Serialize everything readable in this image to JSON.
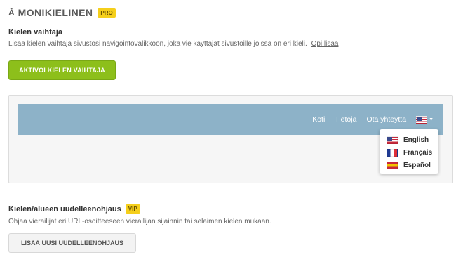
{
  "header": {
    "icon": "language-icon",
    "icon_glyph": "Ă",
    "title": "MONIKIELINEN",
    "badge": "PRO"
  },
  "switcher": {
    "title": "Kielen vaihtaja",
    "description": "Lisää kielen vaihtaja sivustosi navigointovalikkoon, joka vie käyttäjät sivustoille joissa on eri kieli.",
    "learn_more": "Opi lisää",
    "activate_button": "AKTIVOI KIELEN VAIHTAJA"
  },
  "preview": {
    "nav_items": [
      "Koti",
      "Tietoja",
      "Ota yhteyttä"
    ],
    "selected_flag": "us-flag-icon",
    "languages": [
      {
        "label": "English",
        "flag": "us-flag-icon"
      },
      {
        "label": "Français",
        "flag": "fr-flag-icon"
      },
      {
        "label": "Español",
        "flag": "es-flag-icon"
      }
    ],
    "navbar_color": "#8db2c8"
  },
  "redirect": {
    "title": "Kielen/alueen uudelleenohjaus",
    "badge": "VIP",
    "description": "Ohjaa vierailijat eri URL-osoitteeseen vierailijan sijainnin tai selaimen kielen mukaan.",
    "add_button": "LISÄÄ UUSI UUDELLEENOHJAUS"
  },
  "colors": {
    "accent_green": "#8dbf1b",
    "badge_yellow": "#f5cf1b"
  }
}
